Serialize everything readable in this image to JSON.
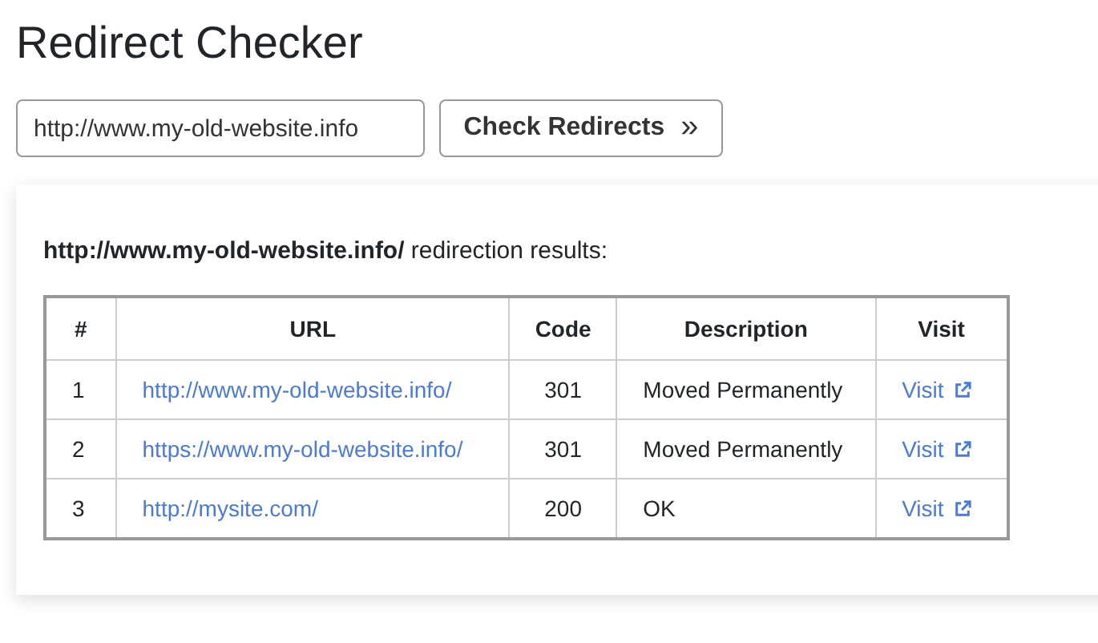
{
  "title": "Redirect Checker",
  "form": {
    "url_value": "http://www.my-old-website.info",
    "button": "Check Redirects",
    "button_icon": "»"
  },
  "results": {
    "heading": "**http://www.my-old-website.info/** redirection results:",
    "columns": [
      "#",
      "URL",
      "Code",
      "Description",
      "Visit"
    ],
    "rows": [
      {
        "index": "1",
        "url": "http://www.my-old-website.info/",
        "code": "301",
        "description": "Moved Permanently",
        "visit": "Visit"
      },
      {
        "index": "2",
        "url": "https://www.my-old-website.info/",
        "code": "301",
        "description": "Moved Permanently",
        "visit": "Visit"
      },
      {
        "index": "3",
        "url": "http://mysite.com/",
        "code": "200",
        "description": "OK",
        "visit": "Visit"
      }
    ]
  }
}
